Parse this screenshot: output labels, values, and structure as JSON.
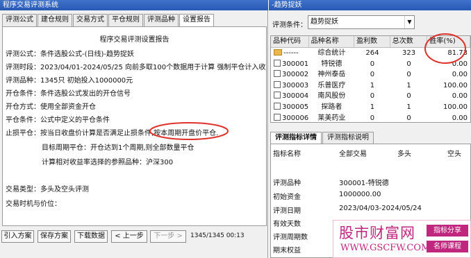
{
  "left_window": {
    "title": "程序交易评测系统",
    "tabs": [
      "评测公式",
      "建仓规则",
      "交易方式",
      "平仓规则",
      "评测品种",
      "设置报告"
    ],
    "report": {
      "title": "程序交易评测设置报告",
      "lines": [
        "评测公式：条件选股公式-(日线)-趋势捉妖",
        "评测时段：2023/04/01-2024/05/25 向前多取100个数据用于计算 强制平仓计入收益",
        "评测品种：1345只 初始投入1000000元",
        "开仓条件：条件选股公式发出的开仓信号",
        "开仓方式：使用全部资金开仓",
        "平仓条件：公式中定义的平仓条件",
        "止损平仓：按当日收盘价计算是否满足止损条件,按本周期开盘价平仓.",
        "目标周期平仓：开仓达到1个周期,则全部数量平仓",
        "计算相对收益率选择的参照品种：沪深300",
        "交易类型：多头及空头评测",
        "交易时机与价位："
      ]
    },
    "buttons": [
      "引入方案",
      "保存方案",
      "下载数据",
      "< 上一步",
      "下一步 >"
    ],
    "status": "1345/1345  00:13"
  },
  "right_window": {
    "title": "-趋势捉妖",
    "condition_label": "评测条件：",
    "condition_value": "趋势捉妖",
    "table": {
      "headers": [
        "品种代码",
        "品种名称",
        "盈利数",
        "总次数",
        "胜率(%)"
      ],
      "rows": [
        [
          "------",
          "综合统计",
          "264",
          "323",
          "81.73"
        ],
        [
          "300001",
          "特锐德",
          "0",
          "0",
          "0.00"
        ],
        [
          "300002",
          "神州泰岳",
          "0",
          "0",
          "0.00"
        ],
        [
          "300003",
          "乐普医疗",
          "1",
          "1",
          "100.00"
        ],
        [
          "300004",
          "南风股份",
          "0",
          "0",
          "0.00"
        ],
        [
          "300005",
          "探路者",
          "1",
          "1",
          "100.00"
        ],
        [
          "300006",
          "莱美药业",
          "0",
          "0",
          "0.00"
        ]
      ]
    },
    "detail_tabs": [
      "评测指标详情",
      "评测指标说明"
    ],
    "detail": {
      "headers": [
        "指标名称",
        "全部交易",
        "多头",
        "空头"
      ],
      "rows": [
        [
          "评测品种",
          "300001-特锐德"
        ],
        [
          "初始资金",
          "1000000.00"
        ],
        [
          "评测日期",
          "2023/04/03-2024/05/24"
        ],
        [
          "有效天数",
          ""
        ],
        [
          "评测周期数",
          ""
        ],
        [
          "期末权益",
          ""
        ]
      ]
    }
  },
  "watermark": {
    "main": "股市财富网",
    "url": "WWW.GSCFW.COM",
    "tag1": "指标分享",
    "tag2": "名师课程"
  },
  "colors": {
    "annotation": "#e0302a",
    "title_bar": "#2859b3",
    "watermark": "#c0267d"
  }
}
